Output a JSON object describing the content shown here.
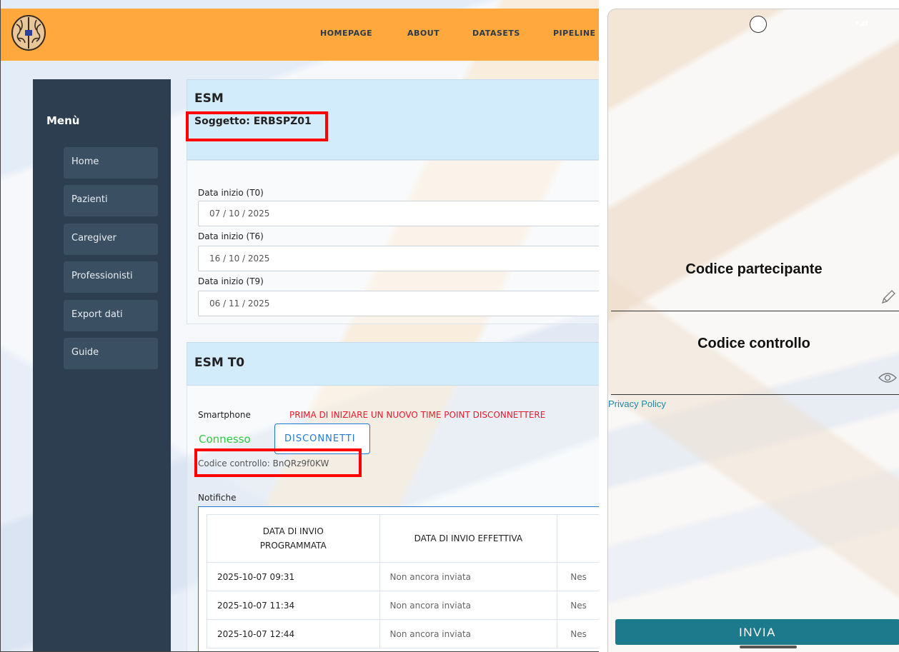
{
  "web": {
    "nav": [
      "HOMEPAGE",
      "ABOUT",
      "DATASETS",
      "PIPELINE"
    ],
    "sidebar": {
      "title": "Menù",
      "items": [
        "Home",
        "Pazienti",
        "Caregiver",
        "Professionisti",
        "Export dati",
        "Guide"
      ]
    },
    "esm": {
      "title": "ESM",
      "subject": "Soggetto: ERBSPZ01"
    },
    "dates": [
      {
        "label": "Data inizio (T0)",
        "value": "07 / 10 / 2025"
      },
      {
        "label": "Data inizio (T6)",
        "value": "16 / 10 / 2025"
      },
      {
        "label": "Data inizio (T9)",
        "value": "06 / 11 / 2025"
      }
    ],
    "t0": {
      "title": "ESM T0",
      "smartphone_label": "Smartphone",
      "warning": "PRIMA DI INIZIARE UN NUOVO TIME POINT DISCONNETTERE",
      "status": "Connesso",
      "disconnect_label": "DISCONNETTI",
      "control_code": "Codice controllo: BnQRz9f0KW",
      "notifications_label": "Notifiche",
      "table": {
        "headers": [
          "DATA DI INVIO PROGRAMMATA",
          "DATA DI INVIO EFFETTIVA",
          ""
        ],
        "rows": [
          [
            "2025-10-07 09:31",
            "Non ancora inviata",
            "Nes"
          ],
          [
            "2025-10-07 11:34",
            "Non ancora inviata",
            "Nes"
          ],
          [
            "2025-10-07 12:44",
            "Non ancora inviata",
            "Nes"
          ]
        ]
      }
    },
    "colors": {
      "topbar": "#ffa83d",
      "sidebar": "#2c3e50",
      "highlight": "#ff0000",
      "connected": "#2ecc40",
      "warning": "#e8192c"
    }
  },
  "phone": {
    "participant_code_label": "Codice partecipante",
    "control_code_label": "Codice controllo",
    "privacy_label": "Privacy Policy",
    "submit_label": "INVIA",
    "icons": [
      "pencil-icon",
      "eye-icon"
    ],
    "colors": {
      "button": "#1d7a8c",
      "link": "#1a8aa8"
    }
  }
}
